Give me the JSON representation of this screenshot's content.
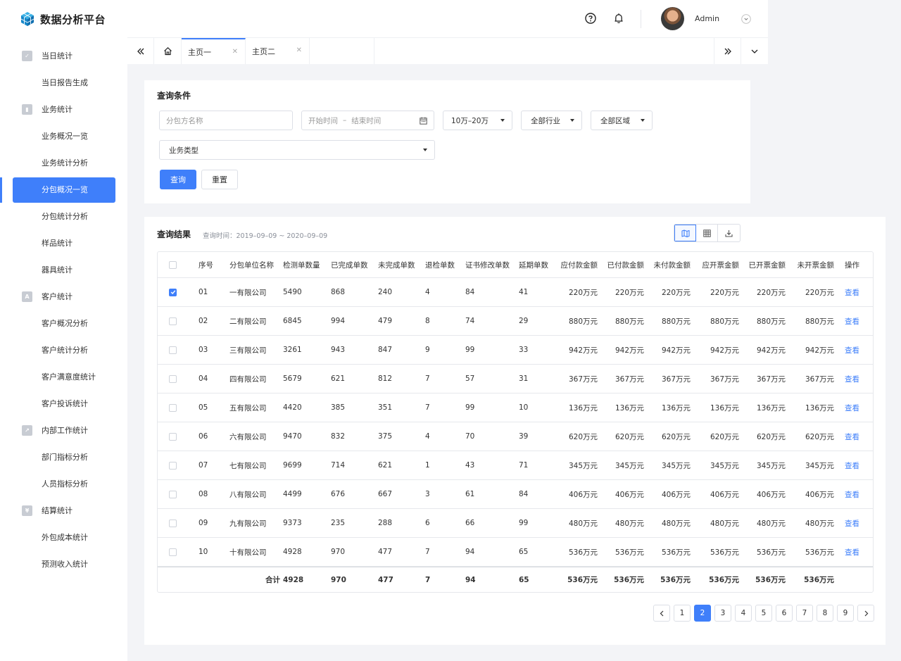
{
  "app": {
    "title": "数据分析平台"
  },
  "header": {
    "user_name": "Admin"
  },
  "sidebar": {
    "items": [
      {
        "label": "当日统计",
        "type": "group",
        "icon": "check-icon"
      },
      {
        "label": "当日报告生成",
        "type": "sub"
      },
      {
        "label": "业务统计",
        "type": "group",
        "icon": "bar-chart-icon"
      },
      {
        "label": "业务概况一览",
        "type": "sub"
      },
      {
        "label": "业务统计分析",
        "type": "sub"
      },
      {
        "label": "分包概况一览",
        "type": "sub",
        "active": true
      },
      {
        "label": "分包统计分析",
        "type": "sub"
      },
      {
        "label": "样品统计",
        "type": "sub"
      },
      {
        "label": "器具统计",
        "type": "sub"
      },
      {
        "label": "客户统计",
        "type": "group",
        "icon": "person-card-icon"
      },
      {
        "label": "客户概况分析",
        "type": "sub"
      },
      {
        "label": "客户统计分析",
        "type": "sub"
      },
      {
        "label": "客户满意度统计",
        "type": "sub"
      },
      {
        "label": "客户投诉统计",
        "type": "sub"
      },
      {
        "label": "内部工作统计",
        "type": "group",
        "icon": "trend-line-icon"
      },
      {
        "label": "部门指标分析",
        "type": "sub"
      },
      {
        "label": "人员指标分析",
        "type": "sub"
      },
      {
        "label": "结算统计",
        "type": "group",
        "icon": "yen-icon"
      },
      {
        "label": "外包成本统计",
        "type": "sub"
      },
      {
        "label": "预测收入统计",
        "type": "sub"
      }
    ]
  },
  "tabs": [
    {
      "label": "主页一",
      "active": true
    },
    {
      "label": "主页二",
      "active": false
    }
  ],
  "query": {
    "title": "查询条件",
    "contractor_placeholder": "分包方名称",
    "start_placeholder": "开始时间",
    "date_sep": "–",
    "end_placeholder": "结束时间",
    "amount_value": "10万–20万",
    "industry_value": "全部行业",
    "region_value": "全部区域",
    "biz_type_placeholder": "业务类型",
    "search_label": "查询",
    "reset_label": "重置"
  },
  "results": {
    "title": "查询结果",
    "query_time": "查询时间：2019–09–09 ~ 2020–09–09",
    "columns": [
      "序号",
      "分包单位名称",
      "检测单数量",
      "已完成单数",
      "未完成单数",
      "退检单数",
      "证书修改单数",
      "延期单数",
      "应付款金额",
      "已付款金额",
      "未付款金额",
      "应开票金额",
      "已开票金额",
      "未开票金额",
      "操作"
    ],
    "rows": [
      {
        "checked": true,
        "no": "01",
        "name": "一有限公司",
        "tests": "5490",
        "done": "868",
        "undone": "240",
        "returned": "4",
        "cert": "84",
        "delayed": "41",
        "payable": "220万元",
        "paid": "220万元",
        "unpaid": "220万元",
        "inv_due": "220万元",
        "invoiced": "220万元",
        "uninvoiced": "220万元",
        "action": "查看"
      },
      {
        "checked": false,
        "no": "02",
        "name": "二有限公司",
        "tests": "6845",
        "done": "994",
        "undone": "479",
        "returned": "8",
        "cert": "74",
        "delayed": "29",
        "payable": "880万元",
        "paid": "880万元",
        "unpaid": "880万元",
        "inv_due": "880万元",
        "invoiced": "880万元",
        "uninvoiced": "880万元",
        "action": "查看"
      },
      {
        "checked": false,
        "no": "03",
        "name": "三有限公司",
        "tests": "3261",
        "done": "943",
        "undone": "847",
        "returned": "9",
        "cert": "99",
        "delayed": "33",
        "payable": "942万元",
        "paid": "942万元",
        "unpaid": "942万元",
        "inv_due": "942万元",
        "invoiced": "942万元",
        "uninvoiced": "942万元",
        "action": "查看"
      },
      {
        "checked": false,
        "no": "04",
        "name": "四有限公司",
        "tests": "5679",
        "done": "621",
        "undone": "812",
        "returned": "7",
        "cert": "57",
        "delayed": "31",
        "payable": "367万元",
        "paid": "367万元",
        "unpaid": "367万元",
        "inv_due": "367万元",
        "invoiced": "367万元",
        "uninvoiced": "367万元",
        "action": "查看"
      },
      {
        "checked": false,
        "no": "05",
        "name": "五有限公司",
        "tests": "4420",
        "done": "385",
        "undone": "351",
        "returned": "7",
        "cert": "99",
        "delayed": "10",
        "payable": "136万元",
        "paid": "136万元",
        "unpaid": "136万元",
        "inv_due": "136万元",
        "invoiced": "136万元",
        "uninvoiced": "136万元",
        "action": "查看"
      },
      {
        "checked": false,
        "no": "06",
        "name": "六有限公司",
        "tests": "9470",
        "done": "832",
        "undone": "375",
        "returned": "4",
        "cert": "70",
        "delayed": "39",
        "payable": "620万元",
        "paid": "620万元",
        "unpaid": "620万元",
        "inv_due": "620万元",
        "invoiced": "620万元",
        "uninvoiced": "620万元",
        "action": "查看"
      },
      {
        "checked": false,
        "no": "07",
        "name": "七有限公司",
        "tests": "9699",
        "done": "714",
        "undone": "621",
        "returned": "1",
        "cert": "43",
        "delayed": "71",
        "payable": "345万元",
        "paid": "345万元",
        "unpaid": "345万元",
        "inv_due": "345万元",
        "invoiced": "345万元",
        "uninvoiced": "345万元",
        "action": "查看"
      },
      {
        "checked": false,
        "no": "08",
        "name": "八有限公司",
        "tests": "4499",
        "done": "676",
        "undone": "667",
        "returned": "3",
        "cert": "61",
        "delayed": "84",
        "payable": "406万元",
        "paid": "406万元",
        "unpaid": "406万元",
        "inv_due": "406万元",
        "invoiced": "406万元",
        "uninvoiced": "406万元",
        "action": "查看"
      },
      {
        "checked": false,
        "no": "09",
        "name": "九有限公司",
        "tests": "9373",
        "done": "235",
        "undone": "288",
        "returned": "6",
        "cert": "66",
        "delayed": "99",
        "payable": "480万元",
        "paid": "480万元",
        "unpaid": "480万元",
        "inv_due": "480万元",
        "invoiced": "480万元",
        "uninvoiced": "480万元",
        "action": "查看"
      },
      {
        "checked": false,
        "no": "10",
        "name": "十有限公司",
        "tests": "4928",
        "done": "970",
        "undone": "477",
        "returned": "7",
        "cert": "94",
        "delayed": "65",
        "payable": "536万元",
        "paid": "536万元",
        "unpaid": "536万元",
        "inv_due": "536万元",
        "invoiced": "536万元",
        "uninvoiced": "536万元",
        "action": "查看"
      }
    ],
    "total": {
      "label": "合计",
      "tests": "4928",
      "done": "970",
      "undone": "477",
      "returned": "7",
      "cert": "94",
      "delayed": "65",
      "payable": "536万元",
      "paid": "536万元",
      "unpaid": "536万元",
      "inv_due": "536万元",
      "invoiced": "536万元",
      "uninvoiced": "536万元"
    }
  },
  "pagination": {
    "pages": [
      "1",
      "2",
      "3",
      "4",
      "5",
      "6",
      "7",
      "8",
      "9"
    ],
    "current": "2"
  },
  "colors": {
    "accent": "#3f7ffa",
    "logo": "#1e9fd8"
  }
}
